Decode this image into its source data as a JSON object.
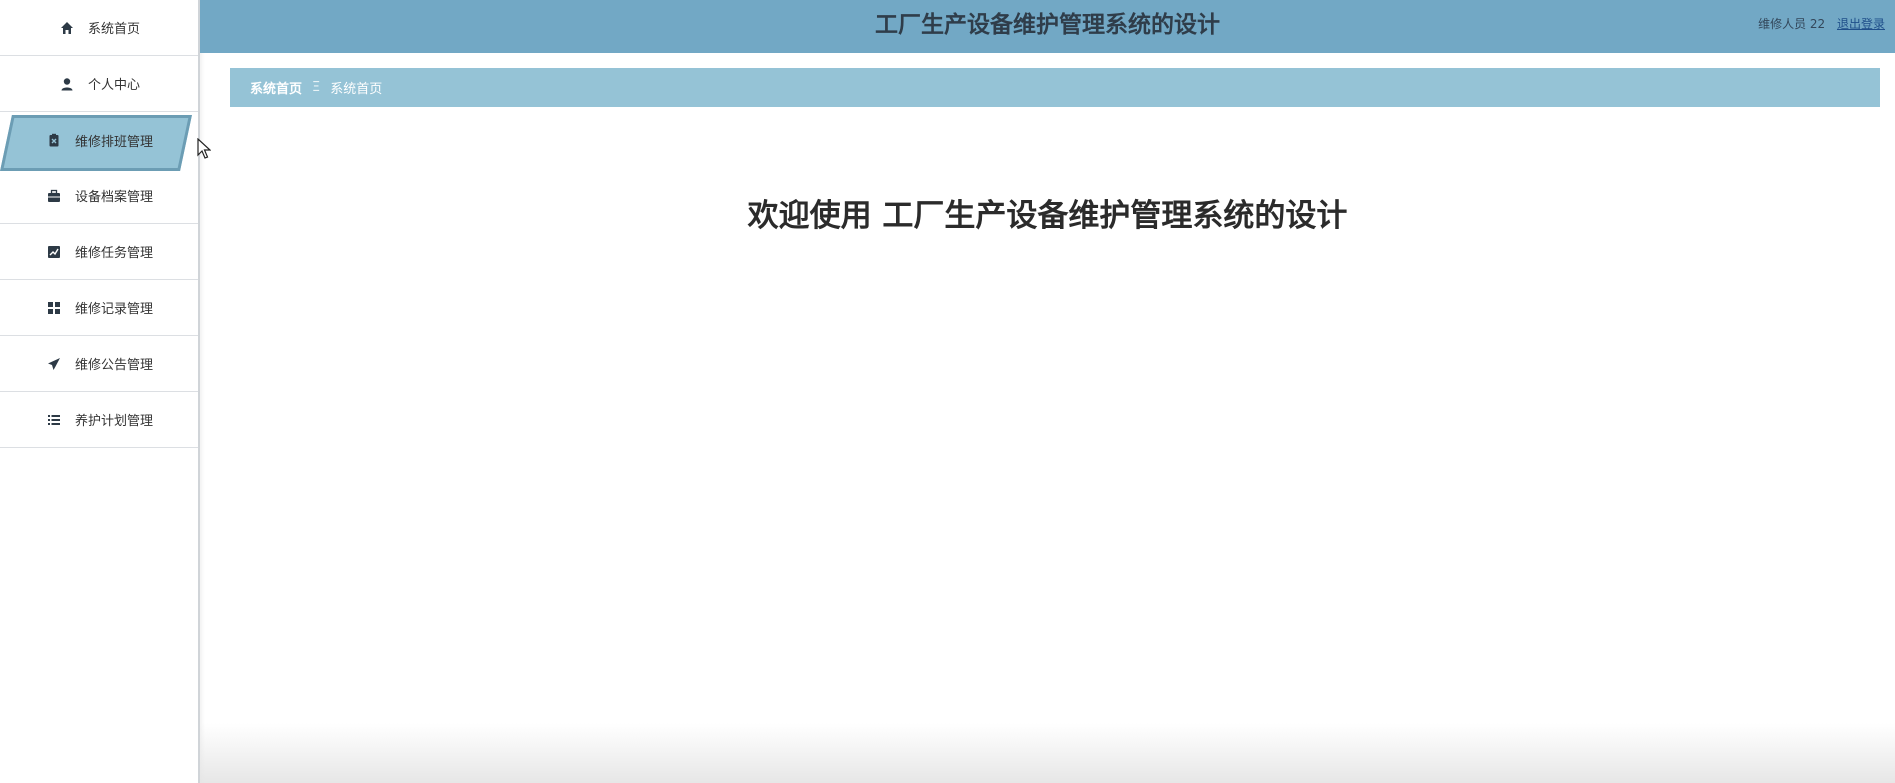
{
  "sidebar": {
    "items": [
      {
        "label": "系统首页",
        "icon": "home-icon"
      },
      {
        "label": "个人中心",
        "icon": "user-icon"
      },
      {
        "label": "维修排班管理",
        "icon": "clipboard-icon",
        "active": true
      },
      {
        "label": "设备档案管理",
        "icon": "briefcase-icon"
      },
      {
        "label": "维修任务管理",
        "icon": "chart-line-icon"
      },
      {
        "label": "维修记录管理",
        "icon": "grid-icon"
      },
      {
        "label": "维修公告管理",
        "icon": "paper-plane-icon"
      },
      {
        "label": "养护计划管理",
        "icon": "list-icon"
      }
    ]
  },
  "header": {
    "title": "工厂生产设备维护管理系统的设计",
    "user_label": "维修人员 22",
    "logout_label": "退出登录"
  },
  "breadcrumb": {
    "home": "系统首页",
    "separator": "Ξ",
    "current": "系统首页"
  },
  "main": {
    "welcome": "欢迎使用 工厂生产设备维护管理系统的设计"
  },
  "colors": {
    "topbar": "#72a8c5",
    "breadcrumb": "#95c3d6",
    "active_item": "#95c3d6"
  }
}
